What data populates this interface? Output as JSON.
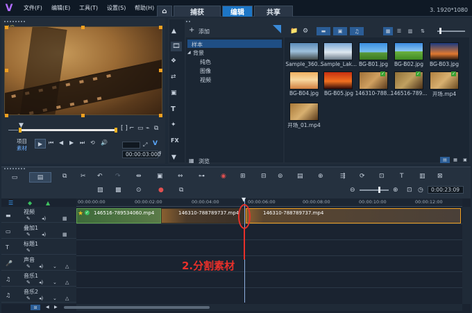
{
  "menu": [
    "文件(F)",
    "编辑(E)",
    "工具(T)",
    "设置(S)",
    "帮助(H)"
  ],
  "tabs": [
    {
      "label": "捕获",
      "active": false
    },
    {
      "label": "编辑",
      "active": true
    },
    {
      "label": "共享",
      "active": false
    }
  ],
  "resolution": "3. 1920*1080",
  "preview": {
    "project_label": "项目",
    "material_label": "素材",
    "timecode": "00:00:03:000",
    "bracket_text": "[ ]"
  },
  "library": {
    "add_label": "添加",
    "tree": {
      "sample": "样本",
      "background": "背景",
      "solid": "纯色",
      "image": "图像",
      "video": "视频"
    },
    "browse_label": "浏览",
    "thumbs": [
      "Sample_360...",
      "Sample_Lak...",
      "BG-B01.jpg",
      "BG-B02.jpg",
      "BG-B03.jpg",
      "BG-B04.jpg",
      "BG-B05.jpg",
      "146310-788...",
      "146516-789...",
      "开场.mp4",
      "开场_01.mp4"
    ]
  },
  "timeline": {
    "timecode": "0:00:23:09",
    "ruler": [
      "00:00:00:00",
      "00:00:02:00",
      "00:00:04:00",
      "00:00:06:00",
      "00:00:08:00",
      "00:00:10:00",
      "00:00:12:00"
    ],
    "tracks": [
      "视频",
      "叠加1",
      "标题1",
      "声音",
      "音乐1",
      "音乐2"
    ],
    "clips": [
      {
        "name": "146516-789534060.mp4"
      },
      {
        "name": "146310-788789737.mp4"
      },
      {
        "name": "146310-788789737.mp4"
      }
    ]
  },
  "annotation": "2.分割素材"
}
